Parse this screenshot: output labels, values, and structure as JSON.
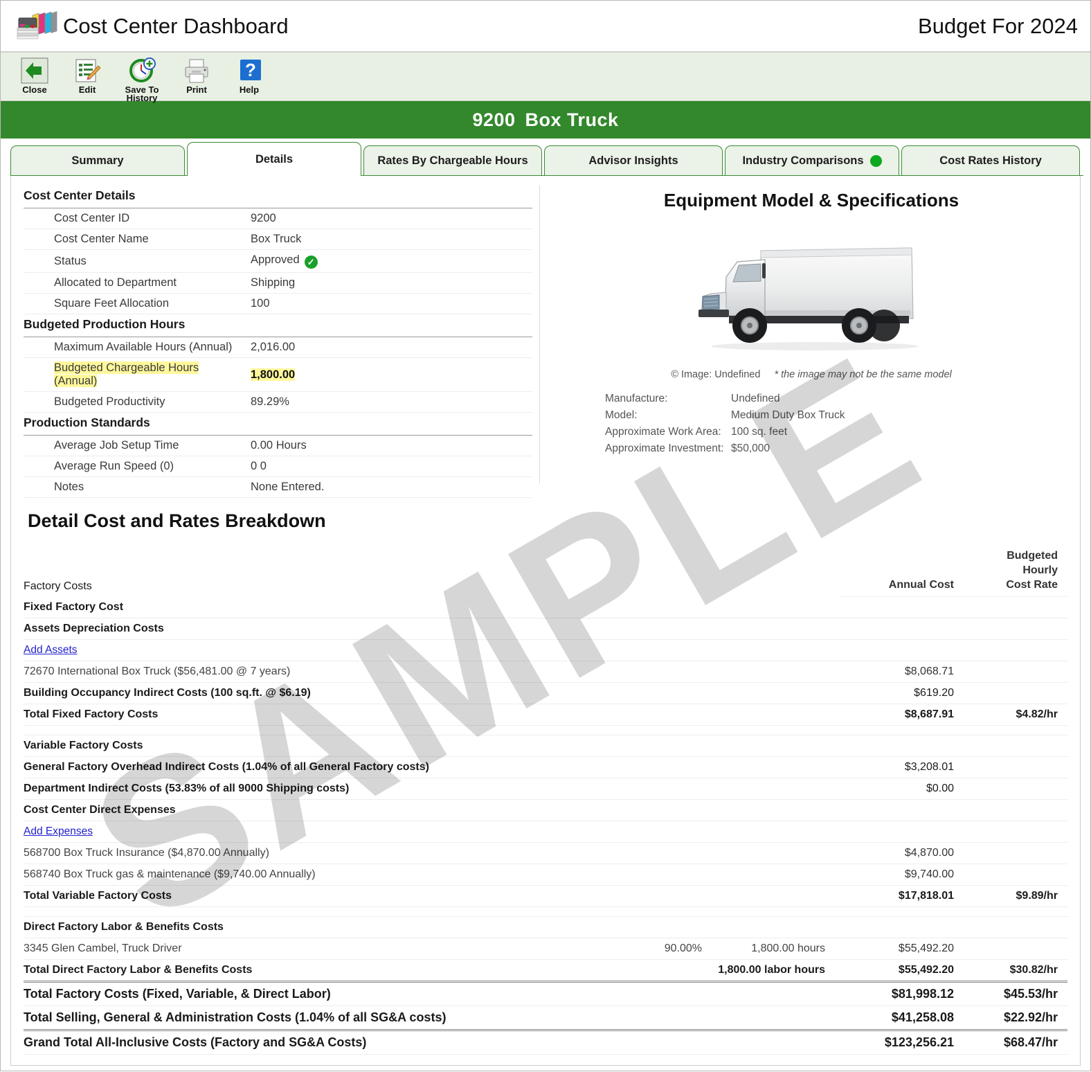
{
  "header": {
    "app_title": "Cost Center Dashboard",
    "budget_year": "Budget For 2024",
    "logo_icon": "printer-cartridges-icon"
  },
  "toolbar": {
    "buttons": [
      {
        "label": "Close",
        "icon": "back-arrow-icon"
      },
      {
        "label": "Edit",
        "icon": "edit-pencil-icon"
      },
      {
        "label": "Save To History",
        "icon": "clock-plus-icon"
      },
      {
        "label": "Print",
        "icon": "printer-icon"
      },
      {
        "label": "Help",
        "icon": "question-mark-icon"
      }
    ]
  },
  "banner": {
    "id": "9200",
    "name": "Box Truck",
    "color": "#33882c"
  },
  "tabs": [
    {
      "label": "Summary",
      "active": false,
      "dot": false
    },
    {
      "label": "Details",
      "active": true,
      "dot": false
    },
    {
      "label": "Rates By Chargeable Hours",
      "active": false,
      "dot": false
    },
    {
      "label": "Advisor Insights",
      "active": false,
      "dot": false
    },
    {
      "label": "Industry Comparisons",
      "active": false,
      "dot": true
    },
    {
      "label": "Cost Rates History",
      "active": false,
      "dot": false
    }
  ],
  "details": {
    "section1_title": "Cost Center Details",
    "rows1": [
      {
        "k": "Cost Center ID",
        "v": "9200"
      },
      {
        "k": "Cost Center Name",
        "v": "Box Truck"
      },
      {
        "k": "Status",
        "v": "Approved",
        "check": true
      },
      {
        "k": "Allocated to Department",
        "v": "Shipping"
      },
      {
        "k": "Square Feet Allocation",
        "v": "100"
      }
    ],
    "section2_title": "Budgeted Production Hours",
    "rows2": [
      {
        "k": "Maximum Available Hours (Annual)",
        "v": "2,016.00"
      },
      {
        "k": "Budgeted Chargeable Hours (Annual)",
        "v": "1,800.00",
        "highlight": true
      },
      {
        "k": "Budgeted Productivity",
        "v": "89.29%"
      }
    ],
    "section3_title": "Production Standards",
    "rows3": [
      {
        "k": "Average Job Setup Time",
        "v": "0.00 Hours"
      },
      {
        "k": "Average Run Speed  (0)",
        "v": "0 0"
      },
      {
        "k": "Notes",
        "v": "None Entered."
      }
    ]
  },
  "equipment": {
    "title": "Equipment Model & Specifications",
    "image_icon": "box-truck-photo",
    "copyright": "© Image: Undefined",
    "disclaimer": "* the image may not be the same model",
    "specs": [
      {
        "k": "Manufacture:",
        "v": "Undefined"
      },
      {
        "k": "Model:",
        "v": "Medium Duty Box Truck"
      },
      {
        "k": "Approximate Work Area:",
        "v": "100 sq. feet"
      },
      {
        "k": "Approximate Investment:",
        "v": "$50,000"
      }
    ]
  },
  "breakdown": {
    "title": "Detail Cost and Rates Breakdown",
    "group_title": "Factory Costs",
    "col_annual": "Annual Cost",
    "col_rate_line1": "Budgeted",
    "col_rate_line2": "Hourly",
    "col_rate_line3": "Cost Rate",
    "rows": [
      {
        "type": "group",
        "indent": 1,
        "label": "Fixed Factory Cost"
      },
      {
        "type": "group",
        "indent": 2,
        "label": "Assets Depreciation Costs"
      },
      {
        "type": "link",
        "indent": 3,
        "label": "Add Assets"
      },
      {
        "type": "item",
        "indent": 3,
        "label": "72670 International Box Truck  ($56,481.00 @ 7 years)",
        "annual": "$8,068.71"
      },
      {
        "type": "group",
        "indent": 2,
        "label": "Building Occupancy Indirect Costs (100 sq.ft. @ $6.19)",
        "annual": "$619.20",
        "annual_normal": true
      },
      {
        "type": "total",
        "indent": 3,
        "label": "Total Fixed Factory Costs",
        "annual": "$8,687.91",
        "rate": "$4.82/hr"
      },
      {
        "type": "spacer"
      },
      {
        "type": "group",
        "indent": 1,
        "label": "Variable Factory Costs"
      },
      {
        "type": "group",
        "indent": 2,
        "label": "General Factory Overhead Indirect Costs (1.04% of all General Factory costs)",
        "annual": "$3,208.01",
        "annual_normal": true
      },
      {
        "type": "group",
        "indent": 2,
        "label": "Department Indirect Costs (53.83% of all 9000 Shipping costs)",
        "annual": "$0.00",
        "annual_normal": true
      },
      {
        "type": "group",
        "indent": 2,
        "label": "Cost Center Direct Expenses"
      },
      {
        "type": "link",
        "indent": 3,
        "label": "Add Expenses"
      },
      {
        "type": "item",
        "indent": 3,
        "label": "568700 Box Truck Insurance     ($4,870.00 Annually)",
        "annual": "$4,870.00"
      },
      {
        "type": "item",
        "indent": 3,
        "label": "568740 Box Truck gas & maintenance     ($9,740.00 Annually)",
        "annual": "$9,740.00"
      },
      {
        "type": "total",
        "indent": 3,
        "label": "Total Variable Factory Costs",
        "annual": "$17,818.01",
        "rate": "$9.89/hr"
      },
      {
        "type": "spacer"
      },
      {
        "type": "group",
        "indent": 1,
        "label": "Direct Factory Labor & Benefits Costs"
      },
      {
        "type": "item",
        "indent": 2,
        "label": "3345 Glen Cambel, Truck Driver",
        "pct": "90.00%",
        "hours": "1,800.00 hours",
        "annual": "$55,492.20"
      },
      {
        "type": "total",
        "indent": 3,
        "label": "Total Direct Factory Labor & Benefits Costs",
        "hours": "1,800.00 labor hours",
        "annual": "$55,492.20",
        "rate": "$30.82/hr"
      }
    ],
    "footer_rows": [
      {
        "label": "Total Factory Costs (Fixed, Variable, & Direct Labor)",
        "annual": "$81,998.12",
        "rate": "$45.53/hr",
        "rule": "double"
      },
      {
        "label": "Total Selling, General & Administration Costs (1.04% of all SG&A costs)",
        "annual": "$41,258.08",
        "rate": "$22.92/hr",
        "rule": "none"
      },
      {
        "label": "Grand Total All-Inclusive Costs (Factory and SG&A Costs)",
        "annual": "$123,256.21",
        "rate": "$68.47/hr",
        "rule": "double",
        "indent": true
      }
    ]
  },
  "watermark": {
    "text": "SAMPLE"
  }
}
